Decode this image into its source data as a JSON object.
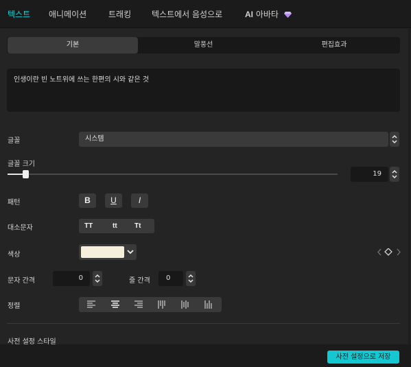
{
  "top_tabs": [
    {
      "label": "텍스트",
      "active": true
    },
    {
      "label": "애니메이션"
    },
    {
      "label": "트래킹"
    },
    {
      "label": "텍스트에서 음성으로"
    },
    {
      "label_ai": "AI",
      "label": "아바타",
      "icon": "gem-icon"
    }
  ],
  "sub_tabs": [
    {
      "label": "기본",
      "active": true
    },
    {
      "label": "말풍선"
    },
    {
      "label": "편집효과"
    }
  ],
  "text_input": {
    "value": "인생이란 빈 노트위에 쓰는 한편의 시와 같은 것"
  },
  "font": {
    "label": "글꼴",
    "value": "시스템"
  },
  "font_size": {
    "label": "글꼴 크기",
    "value": "19",
    "slider_fraction": 0.055
  },
  "pattern": {
    "label": "패턴",
    "buttons": [
      "B",
      "U",
      "I"
    ]
  },
  "case": {
    "label": "대소문자",
    "options": [
      "TT",
      "tt",
      "Tt"
    ]
  },
  "color": {
    "label": "색상",
    "value": "#f8eedc"
  },
  "spacing": {
    "char_label": "문자 간격",
    "char_value": "0",
    "line_label": "줄 간격",
    "line_value": "0"
  },
  "align": {
    "label": "정렬",
    "icons": [
      "align-left-icon",
      "align-center-icon",
      "align-right-icon",
      "vertical-top-icon",
      "vertical-center-icon",
      "vertical-bottom-icon"
    ]
  },
  "preset": {
    "label": "사전 설정 스타일"
  },
  "save_button": {
    "label": "사전 설정으로 저장"
  },
  "colors": {
    "accent": "#1fd0d6",
    "save_bg": "#14c7d1"
  }
}
